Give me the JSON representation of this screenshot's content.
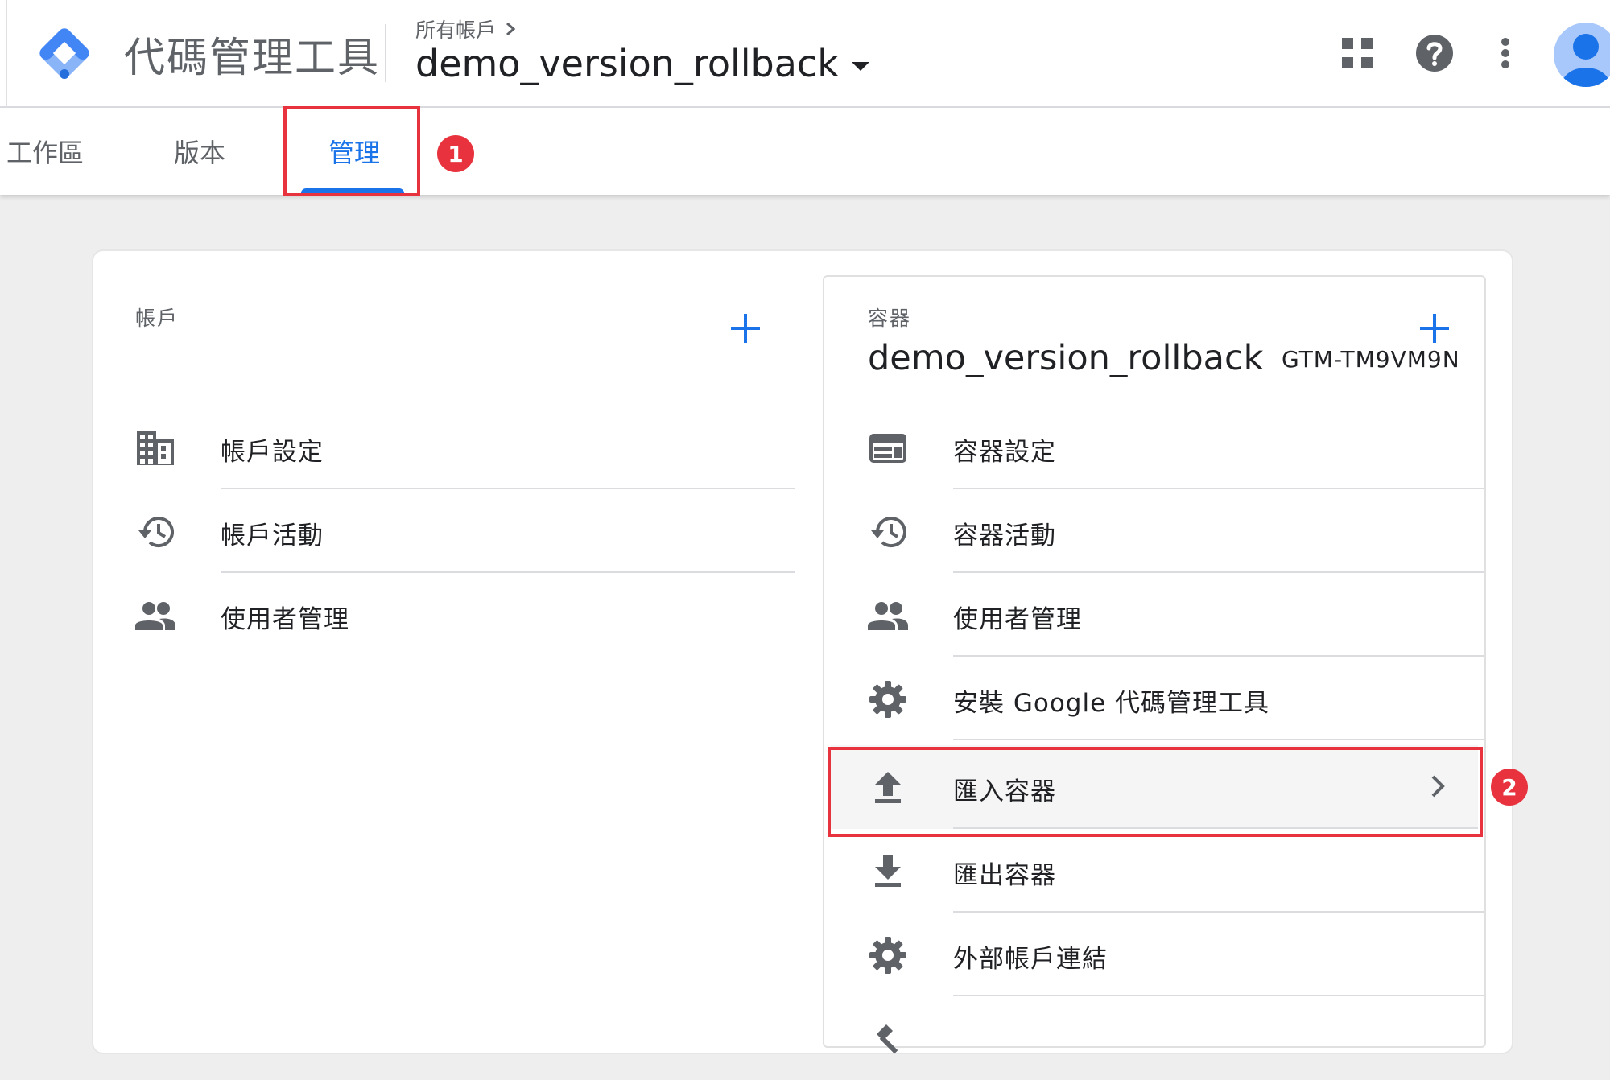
{
  "header": {
    "product_name": "代碼管理工具",
    "breadcrumb": "所有帳戶",
    "container_name": "demo_version_rollback"
  },
  "tabs": [
    {
      "label": "工作區"
    },
    {
      "label": "版本"
    },
    {
      "label": "管理",
      "active": true
    }
  ],
  "annotations": {
    "badge1": "1",
    "badge2": "2"
  },
  "account": {
    "section_label": "帳戶",
    "items": [
      {
        "label": "帳戶設定",
        "icon": "building-icon"
      },
      {
        "label": "帳戶活動",
        "icon": "history-icon"
      },
      {
        "label": "使用者管理",
        "icon": "people-icon"
      }
    ]
  },
  "container": {
    "section_label": "容器",
    "title": "demo_version_rollback",
    "id": "GTM-TM9VM9N",
    "items": [
      {
        "label": "容器設定",
        "icon": "browser-window-icon"
      },
      {
        "label": "容器活動",
        "icon": "history-icon"
      },
      {
        "label": "使用者管理",
        "icon": "people-icon"
      },
      {
        "label": "安裝 Google 代碼管理工具",
        "icon": "gear-icon"
      },
      {
        "label": "匯入容器",
        "icon": "upload-icon"
      },
      {
        "label": "匯出容器",
        "icon": "download-icon"
      },
      {
        "label": "外部帳戶連結",
        "icon": "gear-icon"
      },
      {
        "label": "",
        "icon": "hammer-icon"
      }
    ]
  },
  "colors": {
    "accent": "#1a73e8",
    "annotation": "#e8333f"
  }
}
